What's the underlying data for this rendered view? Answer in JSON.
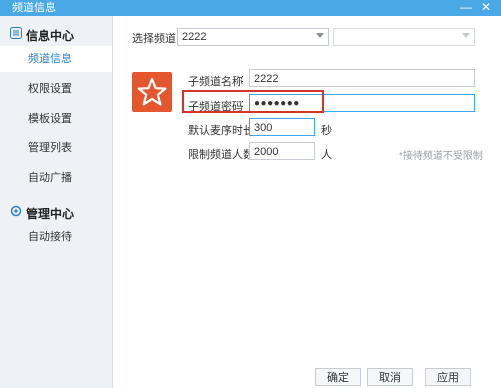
{
  "window": {
    "title": "频道信息",
    "minimize": "—",
    "close": "✕"
  },
  "sidebar": {
    "groups": [
      {
        "label": "信息中心",
        "icon": "list-icon"
      },
      {
        "label": "管理中心",
        "icon": "gear-icon"
      }
    ],
    "info_items": [
      {
        "label": "频道信息"
      },
      {
        "label": "权限设置"
      },
      {
        "label": "模板设置"
      },
      {
        "label": "管理列表"
      },
      {
        "label": "自动广播"
      }
    ],
    "manage_items": [
      {
        "label": "自动接待"
      }
    ]
  },
  "main": {
    "select_channel_label": "选择频道:",
    "select_channel_value": "2222",
    "select_sub_value": "",
    "sub_name_label": "子频道名称",
    "sub_name_colon": ":",
    "sub_name_value": "2222",
    "sub_pwd_label": "子频道密码",
    "sub_pwd_colon": ":",
    "sub_pwd_value": "●●●●●●●",
    "mic_time_label": "默认麦序时长:",
    "mic_time_value": "300",
    "mic_time_unit": "秒",
    "limit_label": "限制频道人数:",
    "limit_value": "2000",
    "limit_unit": "人",
    "limit_hint": "*接待频道不受限制"
  },
  "footer": {
    "ok": "确定",
    "cancel": "取消",
    "apply": "应用"
  },
  "colors": {
    "titlebar": "#4aa8e6",
    "accent": "#2a84cc",
    "star_box": "#e4572e",
    "highlight": "#d9322b"
  }
}
